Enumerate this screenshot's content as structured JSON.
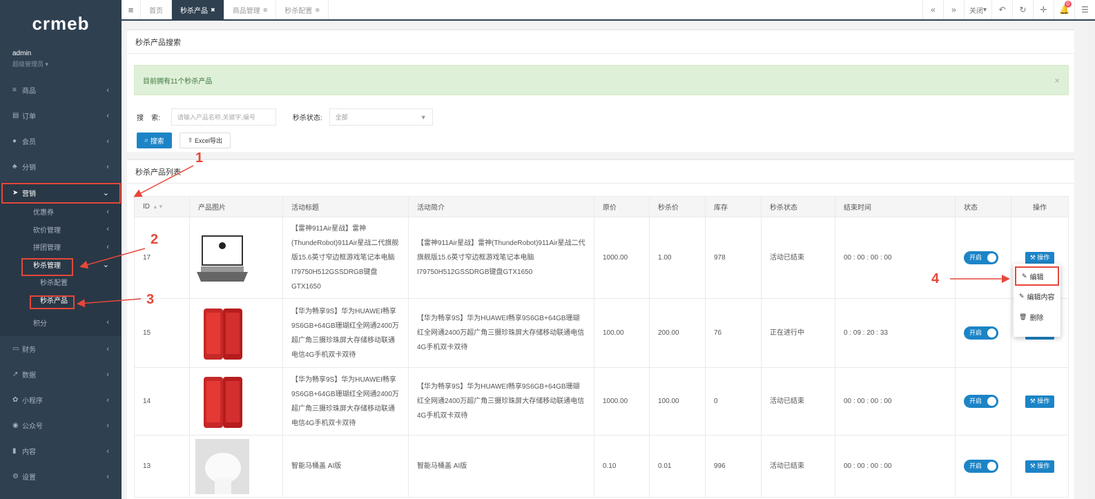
{
  "brand": {
    "logo": "crmeb"
  },
  "user": {
    "name": "admin",
    "role": "超级管理员"
  },
  "sidebar": {
    "items_top": [
      {
        "label": "商品",
        "icon": "list-icon"
      },
      {
        "label": "订单",
        "icon": "doc-icon"
      },
      {
        "label": "会员",
        "icon": "user-icon"
      },
      {
        "label": "分销",
        "icon": "users-icon"
      }
    ],
    "marketing": {
      "label": "营销",
      "icon": "send-icon"
    },
    "marketing_sub": [
      {
        "label": "优惠券"
      },
      {
        "label": "砍价管理"
      },
      {
        "label": "拼团管理"
      },
      {
        "label": "秒杀管理"
      }
    ],
    "seckill_sub": [
      {
        "label": "秒杀配置"
      },
      {
        "label": "秒杀产品"
      }
    ],
    "points": {
      "label": "积分"
    },
    "items_bottom": [
      {
        "label": "财务",
        "icon": "money-icon"
      },
      {
        "label": "数据",
        "icon": "chart-icon"
      },
      {
        "label": "小程序",
        "icon": "mini-program-icon"
      },
      {
        "label": "公众号",
        "icon": "wechat-icon"
      },
      {
        "label": "内容",
        "icon": "content-icon"
      },
      {
        "label": "设置",
        "icon": "gear-icon"
      }
    ]
  },
  "tabs": [
    {
      "label": "首页"
    },
    {
      "label": "秒杀产品"
    },
    {
      "label": "商品管理"
    },
    {
      "label": "秒杀配置"
    }
  ],
  "toolbar": {
    "close_label": "关闭"
  },
  "notif_count": "0",
  "search": {
    "title": "秒杀产品搜索",
    "alert": "目前拥有11个秒杀产品",
    "keyword_label": "搜    索:",
    "keyword_placeholder": "请输入产品名称,关键字,编号",
    "status_label": "秒杀状态:",
    "status_value": "全部",
    "search_btn": "搜索",
    "export_btn": "Excel导出"
  },
  "list": {
    "title": "秒杀产品列表",
    "columns": [
      "ID",
      "产品图片",
      "活动标题",
      "活动简介",
      "原价",
      "秒杀价",
      "库存",
      "秒杀状态",
      "结束时间",
      "状态",
      "操作"
    ],
    "rows": [
      {
        "id": "17",
        "title": "【雷神911Air星战】雷神(ThundeRobot)911Air星战二代旗舰版15.6英寸窄边框游戏笔记本电脑I79750H512GSSDRGB键盘GTX1650",
        "intro": "【雷神911Air星战】雷神(ThundeRobot)911Air星战二代旗舰版15.6英寸窄边框游戏笔记本电脑I79750H512GSSDRGB键盘GTX1650",
        "price": "1000.00",
        "sale": "1.00",
        "stock": "978",
        "status": "活动已结束",
        "end": "00 : 00 : 00 : 00",
        "toggle": "开启",
        "op": "操作",
        "img": "laptop"
      },
      {
        "id": "15",
        "title": "【华为畅享9S】华为HUAWEI畅享9S6GB+64GB珊瑚红全网通2400万超广角三摄珍珠屏大存储移动联通电信4G手机双卡双待",
        "intro": "【华为畅享9S】华为HUAWEI畅享9S6GB+64GB珊瑚红全网通2400万超广角三摄珍珠屏大存储移动联通电信4G手机双卡双待",
        "price": "100.00",
        "sale": "200.00",
        "stock": "76",
        "status": "正在进行中",
        "end": "0 : 09 : 20 : 33",
        "toggle": "开启",
        "op": "操作",
        "img": "phone"
      },
      {
        "id": "14",
        "title": "【华为畅享9S】华为HUAWEI畅享9S6GB+64GB珊瑚红全网通2400万超广角三摄珍珠屏大存储移动联通电信4G手机双卡双待",
        "intro": "【华为畅享9S】华为HUAWEI畅享9S6GB+64GB珊瑚红全网通2400万超广角三摄珍珠屏大存储移动联通电信4G手机双卡双待",
        "price": "1000.00",
        "sale": "100.00",
        "stock": "0",
        "status": "活动已结束",
        "end": "00 : 00 : 00 : 00",
        "toggle": "开启",
        "op": "操作",
        "img": "phone"
      },
      {
        "id": "13",
        "title": "智能马桶盖 AI版",
        "intro": "智能马桶盖 AI版",
        "price": "0.10",
        "sale": "0.01",
        "stock": "996",
        "status": "活动已结束",
        "end": "00 : 00 : 00 : 00",
        "toggle": "开启",
        "op": "操作",
        "img": "toilet"
      }
    ]
  },
  "dropdown": {
    "items": [
      {
        "label": "编辑",
        "icon": "✎"
      },
      {
        "label": "编辑内容",
        "icon": "✎"
      },
      {
        "label": "删除",
        "icon": "🗑"
      }
    ]
  },
  "annotations": {
    "a1": "1",
    "a2": "2",
    "a3": "3",
    "a4": "4"
  },
  "colors": {
    "sidebar": "#2f4050",
    "primary": "#1c84c6",
    "annotation": "#e6473a",
    "alert_bg": "#dff0d8"
  }
}
